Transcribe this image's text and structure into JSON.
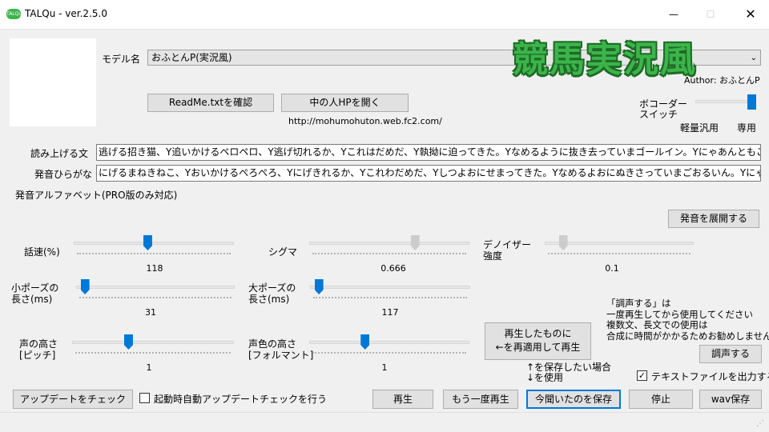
{
  "window": {
    "title": "TALQu - ver.2.5.0",
    "icon_text": "TALQu",
    "minimize": "—",
    "maximize": "☐",
    "close": "✕"
  },
  "overlay_title": "競馬実況風",
  "model": {
    "label": "モデル名",
    "value": "おふとんP(実況風)",
    "author": "Author: おふとんP"
  },
  "buttons": {
    "readme": "ReadMe.txtを確認",
    "homepage": "中の人HPを開く",
    "expand_pronunciation": "発音を展開する",
    "reapply": "再生したものに\n←を再適用して再生",
    "adjust_voice": "調声する",
    "check_update": "アップデートをチェック",
    "play": "再生",
    "replay": "もう一度再生",
    "save_heard": "今聞いたのを保存",
    "stop": "停止",
    "wav_save": "wav保存"
  },
  "homepage_url": "http://mohumohuton.web.fc2.com/",
  "vocoder": {
    "label": "ボコーダー\nスイッチ",
    "left": "軽量汎用",
    "right": "専用",
    "level": 1.0
  },
  "read_text": {
    "label": "読み上げる文",
    "value": "逃げる招き猫、Y追いかけるペロペロ、Y逃げ切れるか、Yこれはだめだ、Y執拗に迫ってきた。Yなめるように抜き去っていまゴールイン。Yにゃあんともこれは逃げ切れない"
  },
  "hiragana": {
    "label": "発音ひらがな",
    "value": "にげるまねきねこ、Yおいかけるぺろぺろ、Yにげきれるか、Yこれわだめだ、Yしつよおにせまってきた。Yなめるよおにぬきさっていまごおるいん。Yにゃあんともこれわにげきれない。"
  },
  "alphabet_label": "発音アルファベット(PRO版のみ対応)",
  "sliders": {
    "speed": {
      "label": "話速(%)",
      "value": "118",
      "level": 0.46
    },
    "sigma": {
      "label": "シグマ",
      "value": "0.666",
      "level": 0.67
    },
    "denoiser": {
      "label": "デノイザー\n強度",
      "value": "0.1",
      "level": 0.1
    },
    "small_pause": {
      "label": "小ポーズの\n長さ(ms)",
      "value": "31",
      "level": 0.03
    },
    "large_pause": {
      "label": "大ポーズの\n長さ(ms)",
      "value": "117",
      "level": 0.03
    },
    "pitch": {
      "label": "声の高さ\n[ピッチ]",
      "value": "1",
      "level": 0.34
    },
    "formant": {
      "label": "声色の高さ\n[フォルマント]",
      "value": "1",
      "level": 0.34
    }
  },
  "adjust_note": "「調声する」は\n一度再生してから使用してください\n複数文、長文での使用は\n合成に時間がかかるためお勧めしません",
  "save_hint": "↑を保存したい場合\n↓を使用",
  "text_file_output": {
    "label": "テキストファイルを出力する",
    "checked": true
  },
  "auto_update": {
    "label": "起動時自動アップデートチェックを行う",
    "checked": false
  }
}
